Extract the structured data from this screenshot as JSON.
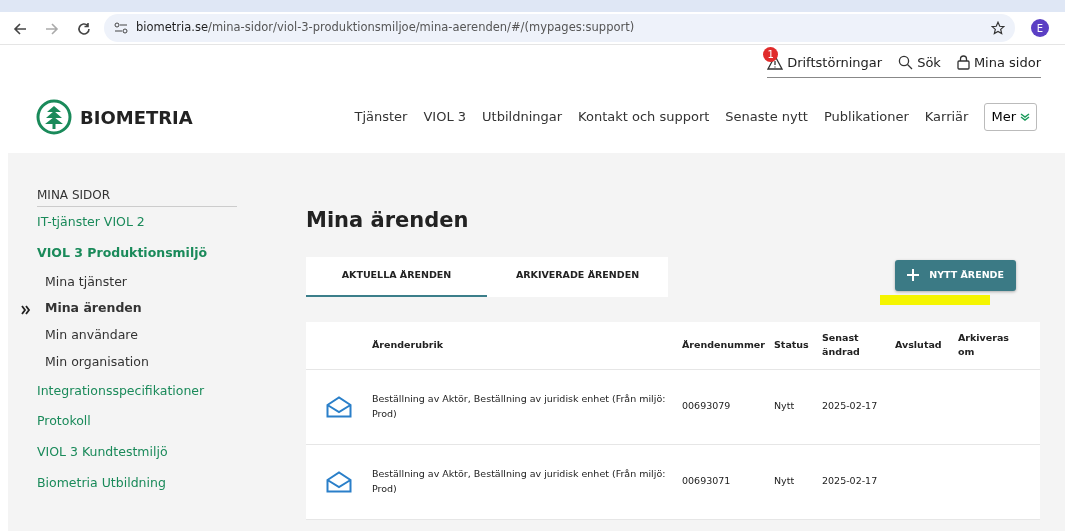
{
  "browser": {
    "url_host": "biometria.se",
    "url_path": "/mina-sidor/viol-3-produktionsmiljoe/mina-aerenden/#/(mypages:support)",
    "profile_initial": "E"
  },
  "utility_nav": {
    "alerts_badge": "1",
    "items": [
      "Driftstörningar",
      "Sök",
      "Mina sidor"
    ]
  },
  "logo": {
    "text": "BIOMETRIA"
  },
  "main_nav": {
    "items": [
      "Tjänster",
      "VIOL 3",
      "Utbildningar",
      "Kontakt och support",
      "Senaste nytt",
      "Publikationer",
      "Karriär"
    ],
    "more": "Mer"
  },
  "sidebar": {
    "heading": "MINA SIDOR",
    "items": [
      {
        "label": "IT-tjänster VIOL 2"
      },
      {
        "label": "VIOL 3 Produktionsmiljö",
        "children": [
          {
            "label": "Mina tjänster",
            "selected": false
          },
          {
            "label": "Mina ärenden",
            "selected": true
          },
          {
            "label": "Min användare",
            "selected": false
          },
          {
            "label": "Min organisation",
            "selected": false
          }
        ]
      },
      {
        "label": "Integrationsspecifikationer"
      },
      {
        "label": "Protokoll"
      },
      {
        "label": "VIOL 3 Kundtestmiljö"
      },
      {
        "label": "Biometria Utbildning"
      }
    ]
  },
  "page_title": "Mina ärenden",
  "tabs": [
    {
      "label": "AKTUELLA ÄRENDEN",
      "selected": true
    },
    {
      "label": "ARKIVERADE ÄRENDEN",
      "selected": false
    }
  ],
  "new_button": {
    "label": "NYTT ÄRENDE",
    "highlighted": true
  },
  "table": {
    "columns": [
      "Ärenderubrik",
      "Ärendenummer",
      "Status",
      "Senast ändrad",
      "Avslutad",
      "Arkiveras om"
    ],
    "rows": [
      {
        "subject": "Beställning av Aktör, Beställning av juridisk enhet (Från miljö: Prod)",
        "number": "00693079",
        "status": "Nytt",
        "changed": "2025-02-17"
      },
      {
        "subject": "Beställning av Aktör, Beställning av juridisk enhet (Från miljö: Prod)",
        "number": "00693071",
        "status": "Nytt",
        "changed": "2025-02-17"
      }
    ]
  }
}
